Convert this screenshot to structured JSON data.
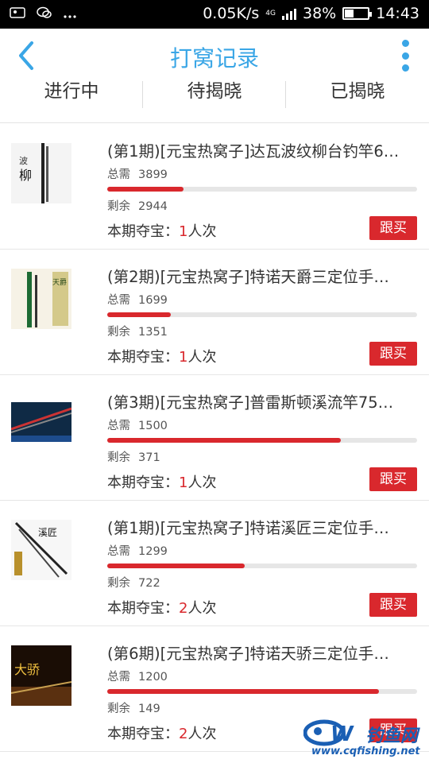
{
  "status_bar": {
    "network_speed": "0.05K/s",
    "battery": "38%",
    "battery_level": 0.38,
    "time": "14:43",
    "network_type": "4G",
    "icons": [
      "image-icon",
      "wechat-icon",
      "more-dots-icon"
    ]
  },
  "header": {
    "title": "打窝记录",
    "back_icon": "chevron-left-icon",
    "more_icon": "vertical-dots-icon"
  },
  "tabs": [
    {
      "label": "进行中"
    },
    {
      "label": "待揭晓"
    },
    {
      "label": "已揭晓"
    }
  ],
  "colors": {
    "accent": "#3aa6e6",
    "red": "#d9282d"
  },
  "items": [
    {
      "title": "(第1期)[元宝热窝子]达瓦波纹柳台钓竿6…",
      "need_label": "总需",
      "need": "3899",
      "remain_label": "剩余",
      "remain": "2944",
      "progress": 0.245,
      "prize_label": "本期夺宝：",
      "prize_count": "1",
      "prize_unit": "人次",
      "buy_label": "跟买"
    },
    {
      "title": "(第2期)[元宝热窝子]特诺天爵三定位手…",
      "need_label": "总需",
      "need": "1699",
      "remain_label": "剩余",
      "remain": "1351",
      "progress": 0.205,
      "prize_label": "本期夺宝：",
      "prize_count": "1",
      "prize_unit": "人次",
      "buy_label": "跟买"
    },
    {
      "title": "(第3期)[元宝热窝子]普雷斯顿溪流竿75…",
      "need_label": "总需",
      "need": "1500",
      "remain_label": "剩余",
      "remain": "371",
      "progress": 0.753,
      "prize_label": "本期夺宝：",
      "prize_count": "1",
      "prize_unit": "人次",
      "buy_label": "跟买"
    },
    {
      "title": "(第1期)[元宝热窝子]特诺溪匠三定位手…",
      "need_label": "总需",
      "need": "1299",
      "remain_label": "剩余",
      "remain": "722",
      "progress": 0.444,
      "prize_label": "本期夺宝：",
      "prize_count": "2",
      "prize_unit": "人次",
      "buy_label": "跟买"
    },
    {
      "title": "(第6期)[元宝热窝子]特诺天骄三定位手…",
      "need_label": "总需",
      "need": "1200",
      "remain_label": "剩余",
      "remain": "149",
      "progress": 0.876,
      "prize_label": "本期夺宝：",
      "prize_count": "2",
      "prize_unit": "人次",
      "buy_label": "跟买"
    }
  ],
  "watermark": {
    "name": "钓鱼网",
    "url": "www.cqfishing.net"
  }
}
